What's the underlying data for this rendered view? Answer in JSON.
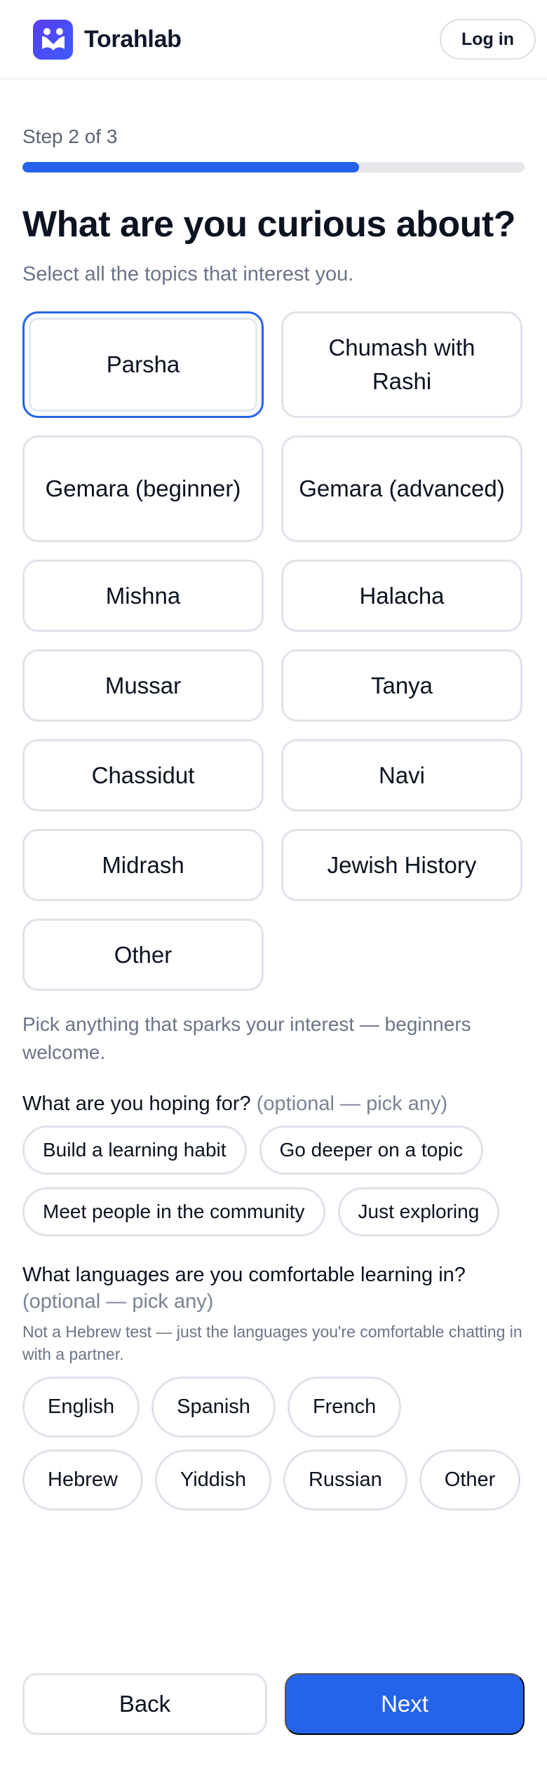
{
  "header": {
    "brand": "Torahlab",
    "login_label": "Log in",
    "logo_icon": "torahlab-logo-icon",
    "accent": "#2563eb"
  },
  "progress": {
    "step_text": "Step 2 of 3",
    "fraction": 0.67
  },
  "main": {
    "title": "What are you curious about?",
    "subtitle": "Select all the topics that interest you."
  },
  "topics": [
    {
      "label": "Parsha",
      "selected": true
    },
    {
      "label": "Chumash with Rashi",
      "selected": false
    },
    {
      "label": "Gemara (beginner)",
      "selected": false
    },
    {
      "label": "Gemara (advanced)",
      "selected": false
    },
    {
      "label": "Mishna",
      "selected": false
    },
    {
      "label": "Halacha",
      "selected": false
    },
    {
      "label": "Mussar",
      "selected": false
    },
    {
      "label": "Tanya",
      "selected": false
    },
    {
      "label": "Chassidut",
      "selected": false
    },
    {
      "label": "Navi",
      "selected": false
    },
    {
      "label": "Midrash",
      "selected": false
    },
    {
      "label": "Jewish History",
      "selected": false
    },
    {
      "label": "Other",
      "selected": false
    }
  ],
  "topics_hint": "Pick anything that sparks your interest — beginners welcome.",
  "hopes": {
    "question": "What are you hoping for?",
    "optional": "(optional — pick any)",
    "options": [
      "Build a learning habit",
      "Go deeper on a topic",
      "Meet people in the community",
      "Just exploring"
    ]
  },
  "languages": {
    "question": "What languages are you comfortable learning in?",
    "optional": "(optional — pick any)",
    "note": "Not a Hebrew test — just the languages you're comfortable chatting in with a partner.",
    "options": [
      "English",
      "Spanish",
      "French",
      "Hebrew",
      "Yiddish",
      "Russian",
      "Other"
    ]
  },
  "footer": {
    "back_label": "Back",
    "next_label": "Next"
  }
}
